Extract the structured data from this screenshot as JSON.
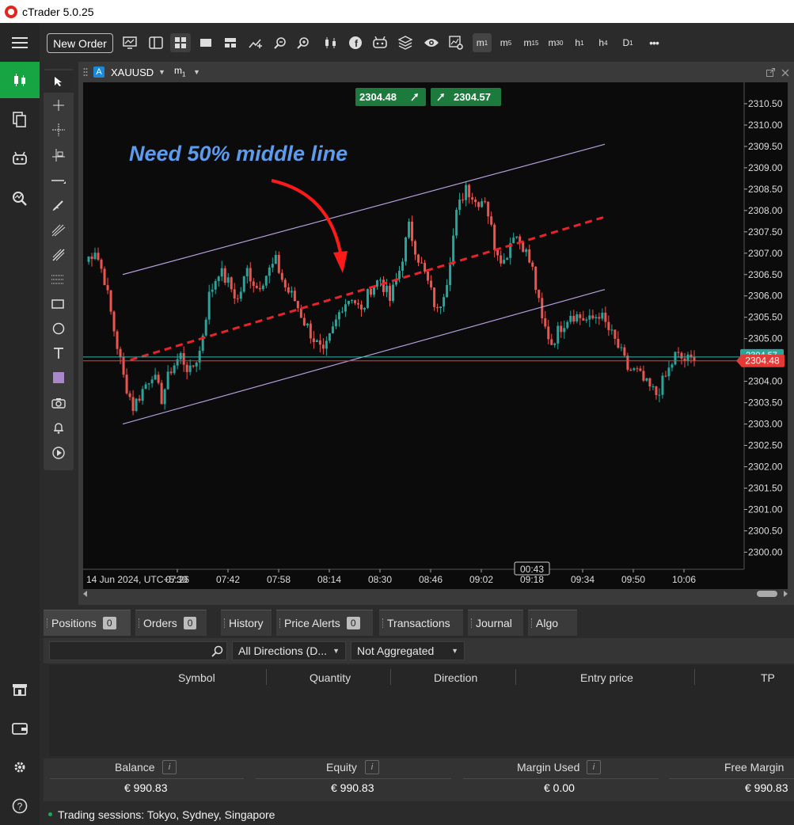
{
  "window": {
    "title": "cTrader 5.0.25"
  },
  "toolbar": {
    "new_order_label": "New Order",
    "timeframes": [
      {
        "base": "m",
        "sub": "1"
      },
      {
        "base": "m",
        "sub": "5"
      },
      {
        "base": "m",
        "sub": "15"
      },
      {
        "base": "m",
        "sub": "30"
      },
      {
        "base": "h",
        "sub": "1"
      },
      {
        "base": "h",
        "sub": "4"
      },
      {
        "base": "D",
        "sub": "1"
      }
    ],
    "more_label": "•••"
  },
  "chart": {
    "symbol_badge": "A",
    "symbol": "XAUUSD",
    "timeframe_base": "m",
    "timeframe_sub": "1",
    "sell_price": "2304.48",
    "buy_price": "2304.57",
    "annotation": "Need 50% middle line",
    "current_bid_label": "2304.48",
    "current_ask_label": "2304.57",
    "countdown": "00:43",
    "colors": {
      "bull": "#26a69a",
      "bear": "#ef5350",
      "channel": "#b39ddb",
      "midline": "#e8232a",
      "annotation": "#5b9bf0",
      "price_btn": "#1b7a3c"
    }
  },
  "chart_data": {
    "type": "candlestick",
    "title": "XAUUSD m1",
    "y_ticks": [
      "2310.50",
      "2310.00",
      "2309.50",
      "2309.00",
      "2308.50",
      "2308.00",
      "2307.50",
      "2307.00",
      "2306.50",
      "2306.00",
      "2305.50",
      "2305.00",
      "2304.50",
      "2304.00",
      "2303.50",
      "2303.00",
      "2302.50",
      "2302.00",
      "2301.50",
      "2301.00",
      "2300.50",
      "2300.00"
    ],
    "x_ticks": [
      "14 Jun 2024, UTC+5:30",
      "07:26",
      "07:42",
      "07:58",
      "08:14",
      "08:30",
      "08:46",
      "09:02",
      "09:18",
      "09:34",
      "09:50",
      "10:06"
    ],
    "ylim": [
      2299.6,
      2311.0
    ],
    "close_path": [
      2306.8,
      2307.1,
      2306.4,
      2305.2,
      2304.1,
      2303.4,
      2303.8,
      2304.2,
      2303.6,
      2304.3,
      2304.6,
      2304.2,
      2304.7,
      2306.0,
      2306.6,
      2306.3,
      2305.9,
      2306.6,
      2306.2,
      2306.5,
      2306.8,
      2306.2,
      2305.9,
      2305.4,
      2305.0,
      2304.6,
      2305.2,
      2305.8,
      2306.0,
      2305.6,
      2306.2,
      2306.4,
      2305.9,
      2306.6,
      2307.6,
      2306.9,
      2306.3,
      2305.6,
      2306.4,
      2307.9,
      2308.6,
      2308.2,
      2308.3,
      2307.2,
      2306.8,
      2307.5,
      2307.2,
      2306.6,
      2305.4,
      2304.9,
      2305.3,
      2305.6,
      2305.5,
      2305.4,
      2305.6,
      2305.2,
      2304.8,
      2304.3,
      2304.2,
      2303.9,
      2303.7,
      2304.1,
      2304.6,
      2304.5,
      2304.48
    ],
    "channel_upper": {
      "from": [
        "07:10",
        2306.5
      ],
      "to": [
        "09:16",
        2309.55
      ]
    },
    "channel_lower": {
      "from": [
        "07:10",
        2303.0
      ],
      "to": [
        "09:16",
        2306.15
      ]
    },
    "middle_line": {
      "from": [
        "07:12",
        2304.5
      ],
      "to": [
        "09:16",
        2307.85
      ]
    }
  },
  "bottom_panel": {
    "tabs": [
      {
        "label": "Positions",
        "count": "0"
      },
      {
        "label": "Orders",
        "count": "0"
      },
      {
        "label": "History",
        "count": ""
      },
      {
        "label": "Price Alerts",
        "count": "0"
      },
      {
        "label": "Transactions",
        "count": ""
      },
      {
        "label": "Journal",
        "count": ""
      },
      {
        "label": "Algo",
        "count": ""
      }
    ],
    "direction_filter": "All Directions (D...",
    "aggregation_filter": "Not Aggregated",
    "columns": [
      "Symbol",
      "Quantity",
      "Direction",
      "Entry price",
      "TP"
    ],
    "summary": {
      "balance_label": "Balance",
      "balance_value": "€ 990.83",
      "equity_label": "Equity",
      "equity_value": "€ 990.83",
      "margin_used_label": "Margin Used",
      "margin_used_value": "€ 0.00",
      "free_margin_label": "Free Margin",
      "free_margin_value": "€ 990.83"
    }
  },
  "status": {
    "text": "Trading sessions: Tokyo, Sydney, Singapore"
  }
}
